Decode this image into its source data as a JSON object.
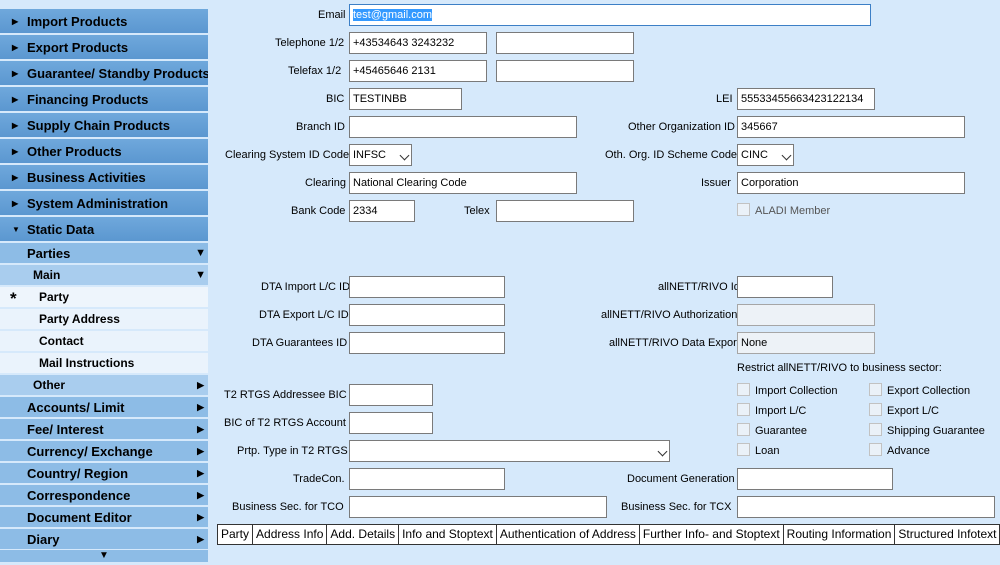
{
  "nav": {
    "top_items": [
      "Import Products",
      "Export Products",
      "Guarantee/ Standby Products",
      "Financing Products",
      "Supply Chain Products",
      "Other Products",
      "Business Activities",
      "System Administration",
      "Static Data"
    ],
    "parties": "Parties",
    "main": "Main",
    "leaves": [
      "Party",
      "Party Address",
      "Contact",
      "Mail Instructions"
    ],
    "other": "Other",
    "sub_items": [
      "Accounts/ Limit",
      "Fee/ Interest",
      "Currency/ Exchange",
      "Country/ Region",
      "Correspondence",
      "Document Editor",
      "Diary"
    ],
    "active_marker": "*"
  },
  "form": {
    "email_label": "Email",
    "email_value": "test@gmail.com",
    "telephone_label": "Telephone 1/2",
    "telephone1": "+43534643 3243232",
    "telephone2": "",
    "telefax_label": "Telefax 1/2",
    "telefax1": "+45465646 2131",
    "telefax2": "",
    "bic_label": "BIC",
    "bic_value": "TESTINBB",
    "lei_label": "LEI",
    "lei_value": "55533455663423122134",
    "branch_label": "Branch ID",
    "branch_value": "",
    "other_org_label": "Other Organization ID",
    "other_org_value": "345667",
    "clearing_sys_label": "Clearing System ID Code",
    "clearing_sys_value": "INFSC",
    "oth_scheme_label": "Oth. Org. ID Scheme Code",
    "oth_scheme_value": "CINC",
    "clearing_label": "Clearing",
    "clearing_value": "National Clearing Code",
    "issuer_label": "Issuer",
    "issuer_value": "Corporation",
    "bank_code_label": "Bank Code",
    "bank_code_value": "2334",
    "telex_label": "Telex",
    "telex_value": "",
    "aladi_label": "ALADI Member",
    "dta_import_label": "DTA Import L/C ID",
    "dta_export_label": "DTA Export L/C ID",
    "dta_guar_label": "DTA Guarantees ID",
    "allnett_id_label": "allNETT/RIVO Id",
    "allnett_auth_label": "allNETT/RIVO Authorization",
    "allnett_export_label": "allNETT/RIVO Data Export",
    "allnett_export_value": "None",
    "restrict_label": "Restrict allNETT/RIVO to business sector:",
    "sectors": [
      "Import Collection",
      "Export Collection",
      "Import L/C",
      "Export L/C",
      "Guarantee",
      "Shipping Guarantee",
      "Loan",
      "Advance"
    ],
    "t2_addressee_label": "T2 RTGS Addressee BIC",
    "t2_account_label": "BIC of T2 RTGS Account",
    "prtp_label": "Prtp. Type in T2 RTGS",
    "tradecon_label": "TradeCon.",
    "doc_gen_label": "Document Generation",
    "bus_tco_label": "Business Sec. for TCO",
    "bus_tcx_label": "Business Sec. for TCX"
  },
  "tabs": [
    "Party",
    "Address Info",
    "Add. Details",
    "Info and Stoptext",
    "Authentication of Address",
    "Further Info- and Stoptext",
    "Routing Information",
    "Structured Infotext"
  ]
}
